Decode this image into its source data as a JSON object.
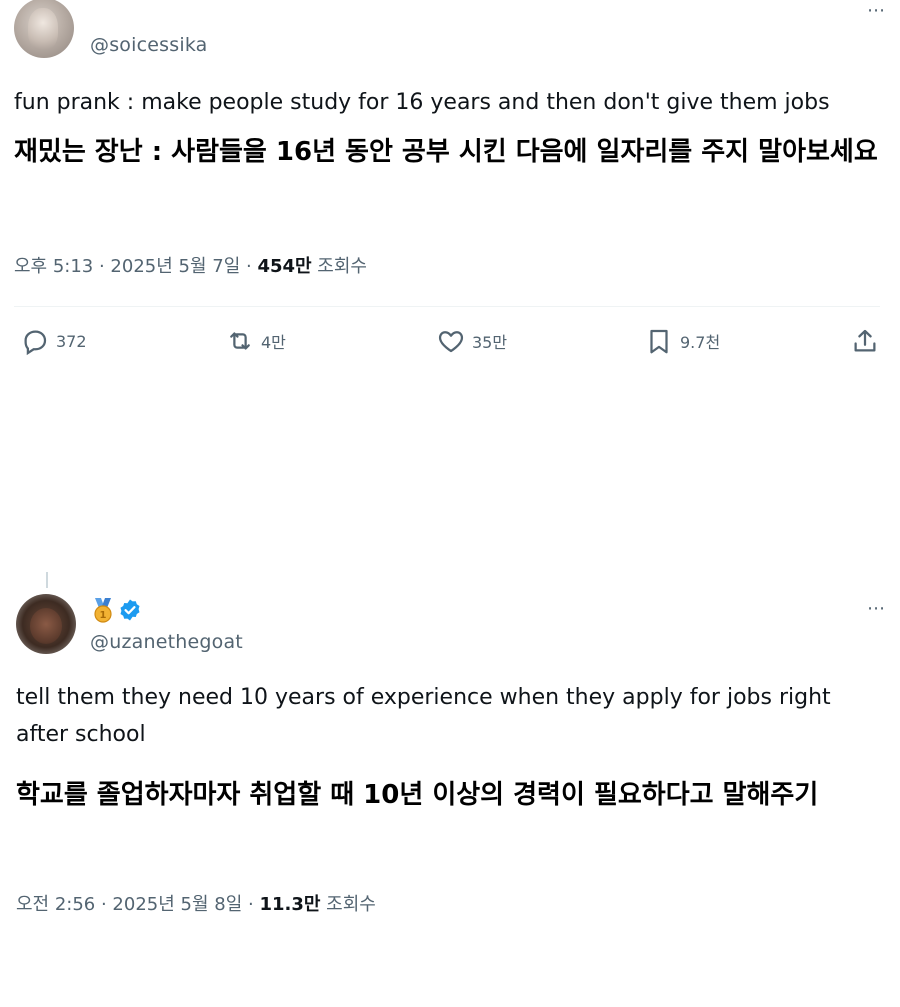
{
  "post1": {
    "handle": "@soicessika",
    "text_en": "fun prank : make people study for 16 years  and then don't give them jobs",
    "text_ko": "재밌는 장난 : 사람들을 16년 동안 공부 시킨 다음에 일자리를 주지 말아보세요",
    "meta_time": "오후 5:13 · 2025년 5월 7일 · ",
    "meta_views": "454만",
    "meta_views_label": " 조회수",
    "actions": {
      "reply": "372",
      "retweet": "4만",
      "like": "35만",
      "bookmark": "9.7천"
    }
  },
  "post2": {
    "handle": "@uzanethegoat",
    "text_en": "tell them they need 10 years of experience when they apply for jobs right after school",
    "text_ko": "학교를 졸업하자마자 취업할 때 10년 이상의 경력이 필요하다고 말해주기",
    "meta_time": "오전 2:56 · 2025년 5월 8일 · ",
    "meta_views": "11.3만",
    "meta_views_label": " 조회수"
  },
  "icons": {
    "more": "more-icon",
    "reply": "reply-icon",
    "retweet": "retweet-icon",
    "like": "heart-icon",
    "bookmark": "bookmark-icon",
    "share": "share-icon",
    "medal": "medal-icon",
    "verified": "verified-badge-icon"
  },
  "colors": {
    "secondary_text": "#536471",
    "primary_text": "#0f1419",
    "verified_blue": "#1d9bf0"
  }
}
